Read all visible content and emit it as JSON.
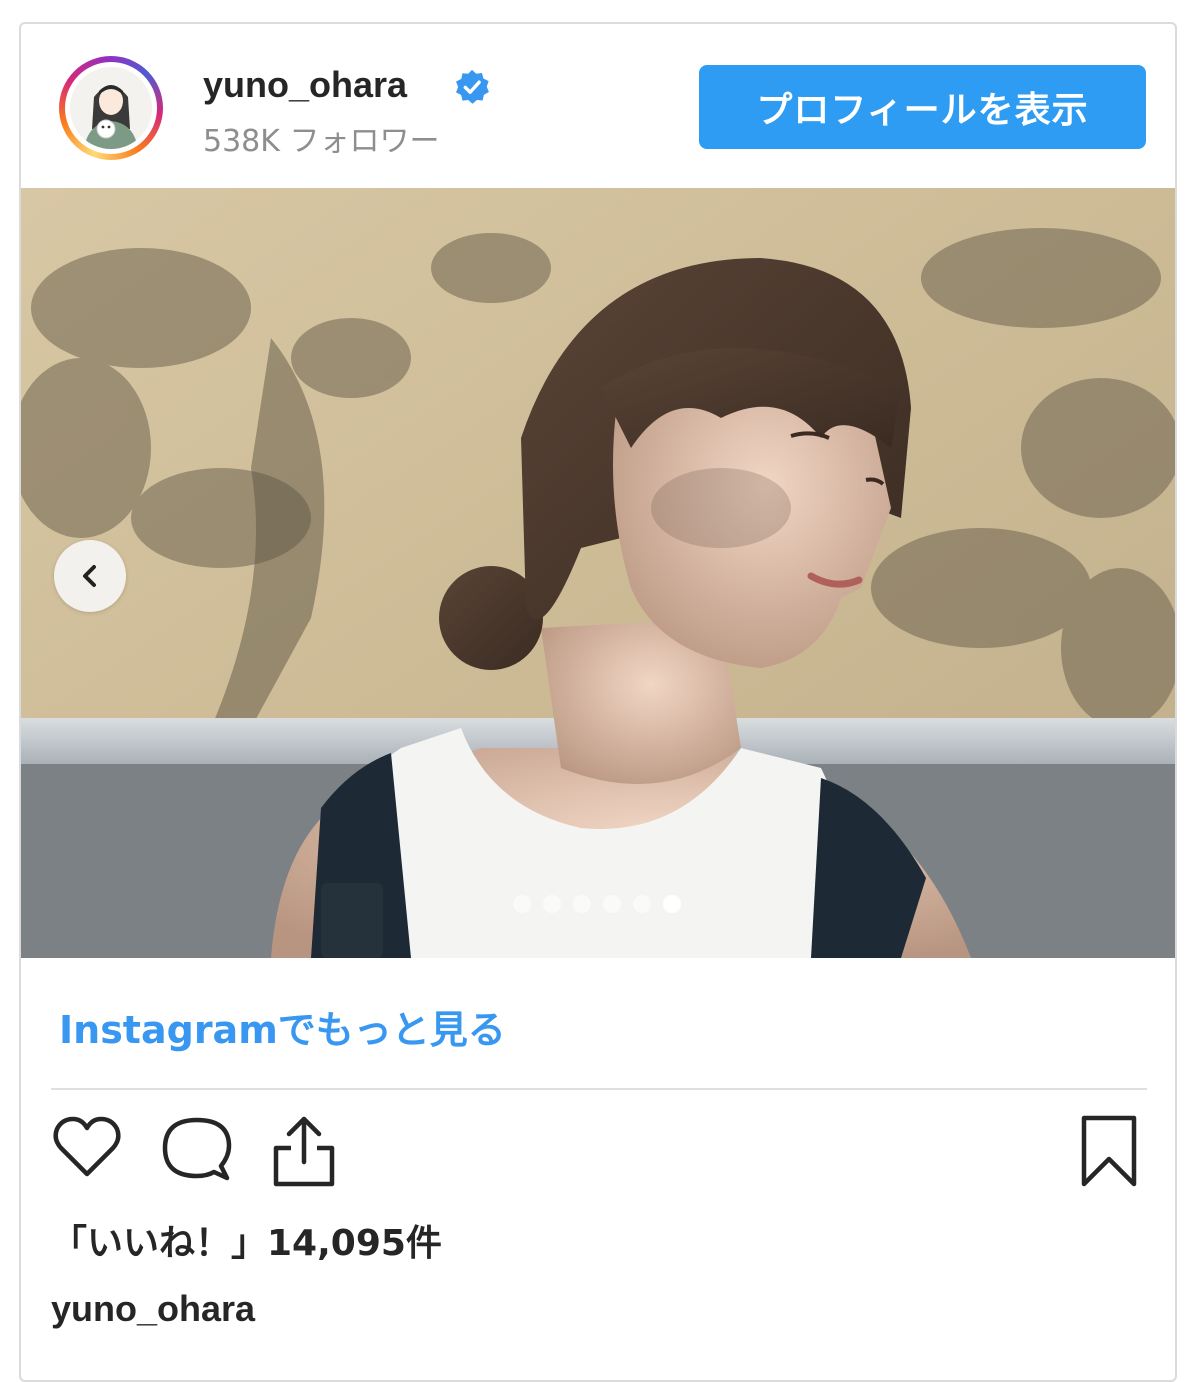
{
  "header": {
    "username": "yuno_ohara",
    "followers": "538K フォロワー",
    "profile_button_label": "プロフィールを表示"
  },
  "carousel": {
    "slide_count": 6,
    "active_index": 5
  },
  "more_link": "Instagramでもっと見る",
  "likes_text": "「いいね！」14,095件",
  "caption_username": "yuno_ohara",
  "colors": {
    "accent_blue": "#3897f0",
    "button_blue": "#2d9cf2",
    "text_dark": "#262626",
    "text_muted": "#8e8e8e"
  },
  "icons": [
    "verified-badge-icon",
    "chevron-left-icon",
    "heart-icon",
    "comment-icon",
    "share-icon",
    "bookmark-icon"
  ]
}
